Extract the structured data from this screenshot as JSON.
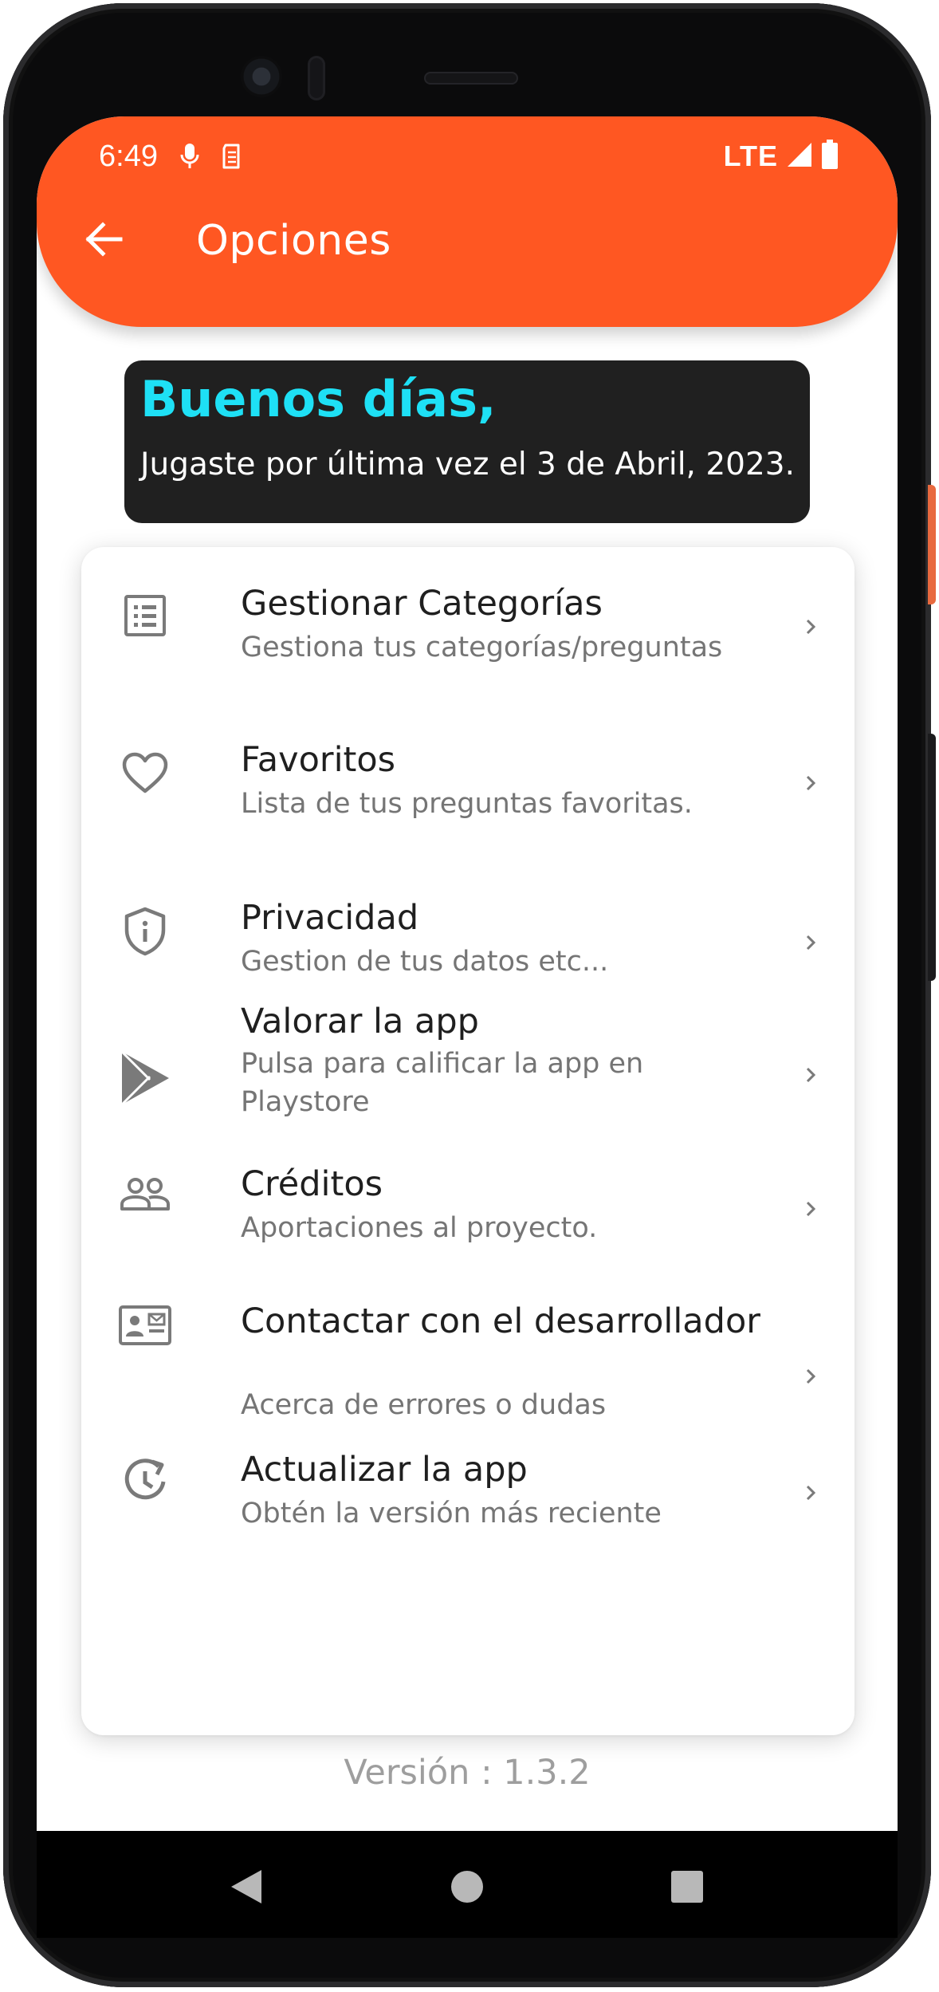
{
  "status_bar": {
    "time": "6:49",
    "network": "LTE",
    "left_icons": [
      "mic-icon",
      "sim-icon"
    ],
    "right_icons": [
      "signal-icon",
      "battery-icon"
    ]
  },
  "app_bar": {
    "title": "Opciones",
    "back_icon": "arrow-back-icon",
    "color": "#ff5722"
  },
  "greeting": {
    "title": "Buenos días,",
    "subtitle": "Jugaste por última vez el 3 de Abril, 2023.",
    "title_color": "#1ee0f5",
    "background": "#202020"
  },
  "menu": {
    "items": [
      {
        "icon": "list-icon",
        "title": "Gestionar Categorías",
        "subtitle": "Gestiona tus categorías/preguntas"
      },
      {
        "icon": "heart-icon",
        "title": "Favoritos",
        "subtitle": "Lista de tus preguntas favoritas."
      },
      {
        "icon": "shield-info-icon",
        "title": "Privacidad",
        "subtitle": "Gestion de tus datos etc..."
      },
      {
        "icon": "play-store-icon",
        "title": "Valorar la app",
        "subtitle": "Pulsa para calificar la app en Playstore"
      },
      {
        "icon": "people-icon",
        "title": "Créditos",
        "subtitle": "Aportaciones al proyecto."
      },
      {
        "icon": "contact-card-icon",
        "title": "Contactar con el desarrollador",
        "subtitle": "Acerca de errores o dudas"
      },
      {
        "icon": "update-icon",
        "title": "Actualizar la app",
        "subtitle": "Obtén la versión más reciente"
      }
    ]
  },
  "footer": {
    "version": "Versión : 1.3.2"
  },
  "nav_bar": {
    "buttons": [
      "back-triangle-icon",
      "home-circle-icon",
      "recents-square-icon"
    ]
  }
}
